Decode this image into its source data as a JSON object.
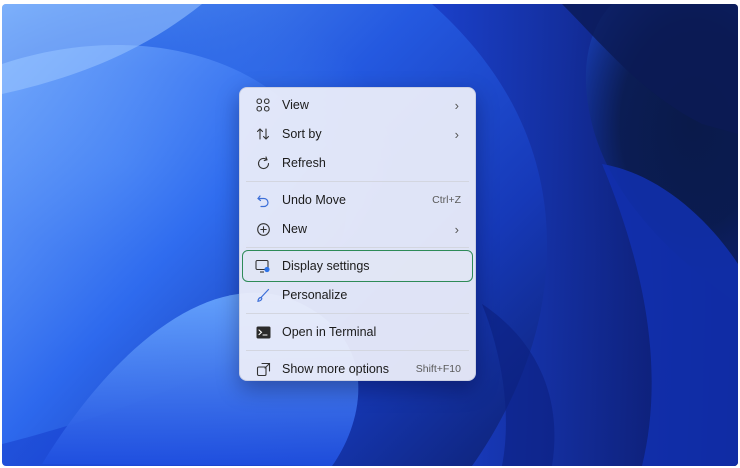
{
  "context_menu": {
    "items": [
      {
        "label": "View",
        "icon": "grid-view-icon",
        "shortcut": "",
        "submenu": true
      },
      {
        "label": "Sort by",
        "icon": "sort-arrows-icon",
        "shortcut": "",
        "submenu": true
      },
      {
        "label": "Refresh",
        "icon": "refresh-icon",
        "shortcut": "",
        "submenu": false
      },
      {
        "label": "Undo Move",
        "icon": "undo-icon",
        "shortcut": "Ctrl+Z",
        "submenu": false
      },
      {
        "label": "New",
        "icon": "plus-circle-icon",
        "shortcut": "",
        "submenu": true
      },
      {
        "label": "Display settings",
        "icon": "display-settings-icon",
        "shortcut": "",
        "submenu": false,
        "highlighted": true
      },
      {
        "label": "Personalize",
        "icon": "brush-icon",
        "shortcut": "",
        "submenu": false
      },
      {
        "label": "Open in Terminal",
        "icon": "terminal-icon",
        "shortcut": "",
        "submenu": false
      },
      {
        "label": "Show more options",
        "icon": "more-options-icon",
        "shortcut": "Shift+F10",
        "submenu": false
      }
    ],
    "submenu_chevron": "›",
    "highlight_color": "#2e8b57"
  }
}
